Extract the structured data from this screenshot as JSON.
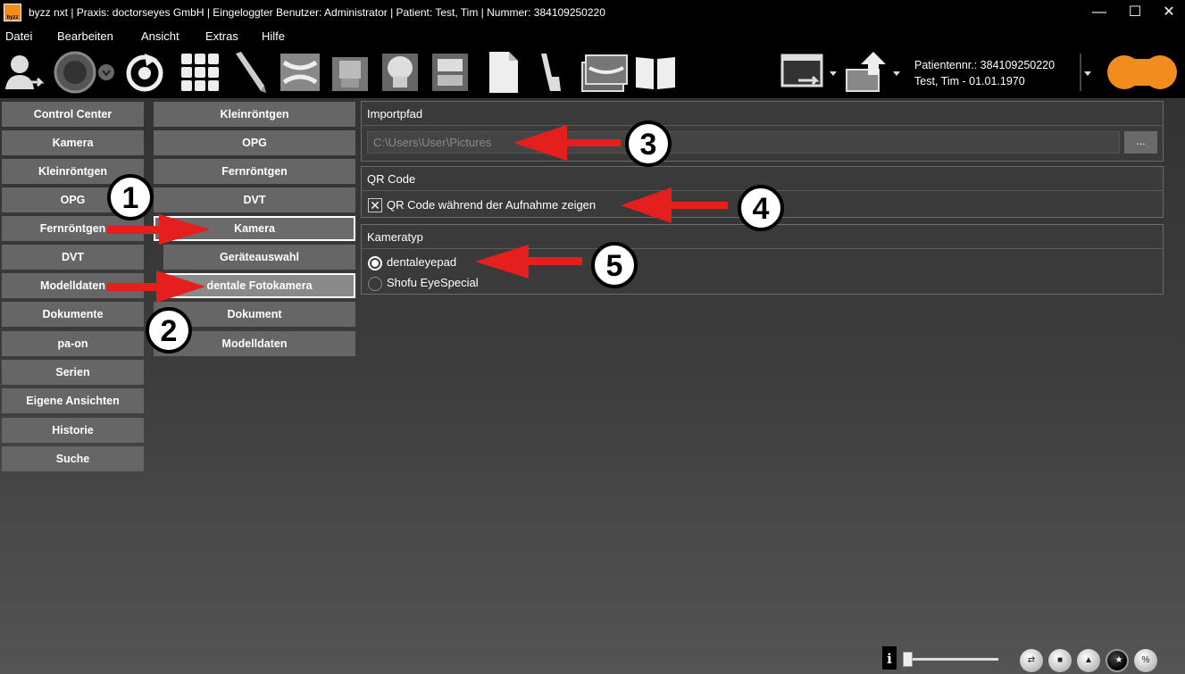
{
  "titlebar": {
    "logo_text": "byzz",
    "title": "byzz nxt  |  Praxis: doctorseyes GmbH  |  Eingeloggter Benutzer: Administrator  |  Patient: Test, Tim   |   Nummer: 384109250220",
    "minimize": "—",
    "maximize": "☐",
    "close": "✕"
  },
  "menu": {
    "items": [
      "Datei",
      "Bearbeiten",
      "Ansicht",
      "Extras",
      "Hilfe"
    ]
  },
  "toolbar": {
    "icons": [
      "patient-icon",
      "record-icon",
      "dropdown-icon",
      "sync-icon",
      "grid-icon",
      "pen-icon",
      "opg-icon",
      "xray-icon",
      "skull-icon",
      "teeth-icon",
      "document-icon",
      "intraoral-camera-icon",
      "gallery-icon",
      "book-icon",
      "export-icon",
      "upload-icon"
    ],
    "patient_number_line": "Patientennr.: 384109250220",
    "patient_name_line": "Test, Tim - 01.01.1970"
  },
  "sidebar": {
    "items": [
      "Control Center",
      "Kamera",
      "Kleinröntgen",
      "OPG",
      "Fernröntgen",
      "DVT",
      "Modelldaten",
      "Dokumente",
      "pa-on",
      "Serien",
      "Eigene Ansichten",
      "Historie",
      "Suche"
    ]
  },
  "subnav": {
    "items": [
      "Kleinröntgen",
      "OPG",
      "Fernröntgen",
      "DVT",
      "Kamera"
    ],
    "sub_items": [
      "Geräteauswahl",
      "dentale Fotokamera"
    ],
    "items_after": [
      "Dokument",
      "Modelldaten"
    ]
  },
  "import_panel": {
    "title": "Importpfad",
    "path_value": "C:\\Users\\User\\Pictures",
    "browse_label": "..."
  },
  "qr_panel": {
    "title": "QR Code",
    "checkbox_label": "QR Code während der Aufnahme zeigen",
    "checked": true,
    "check_mark": "✕"
  },
  "camera_panel": {
    "title": "Kameratyp",
    "options": [
      "dentaleyepad",
      "Shofu EyeSpecial"
    ],
    "selected": "dentaleyepad"
  },
  "annotations": {
    "labels": [
      "1",
      "2",
      "3",
      "4",
      "5"
    ],
    "arrow_color": "#e51e1e"
  },
  "bottom_bar": {
    "info_label": "i",
    "zoom_level": 0,
    "button_glyphs": [
      "⇄",
      "■",
      "▲",
      "★",
      "%"
    ]
  },
  "colors": {
    "brand_orange": "#f28c1e",
    "nav_button": "#666666",
    "panel_bg": "#3a3a3a"
  }
}
